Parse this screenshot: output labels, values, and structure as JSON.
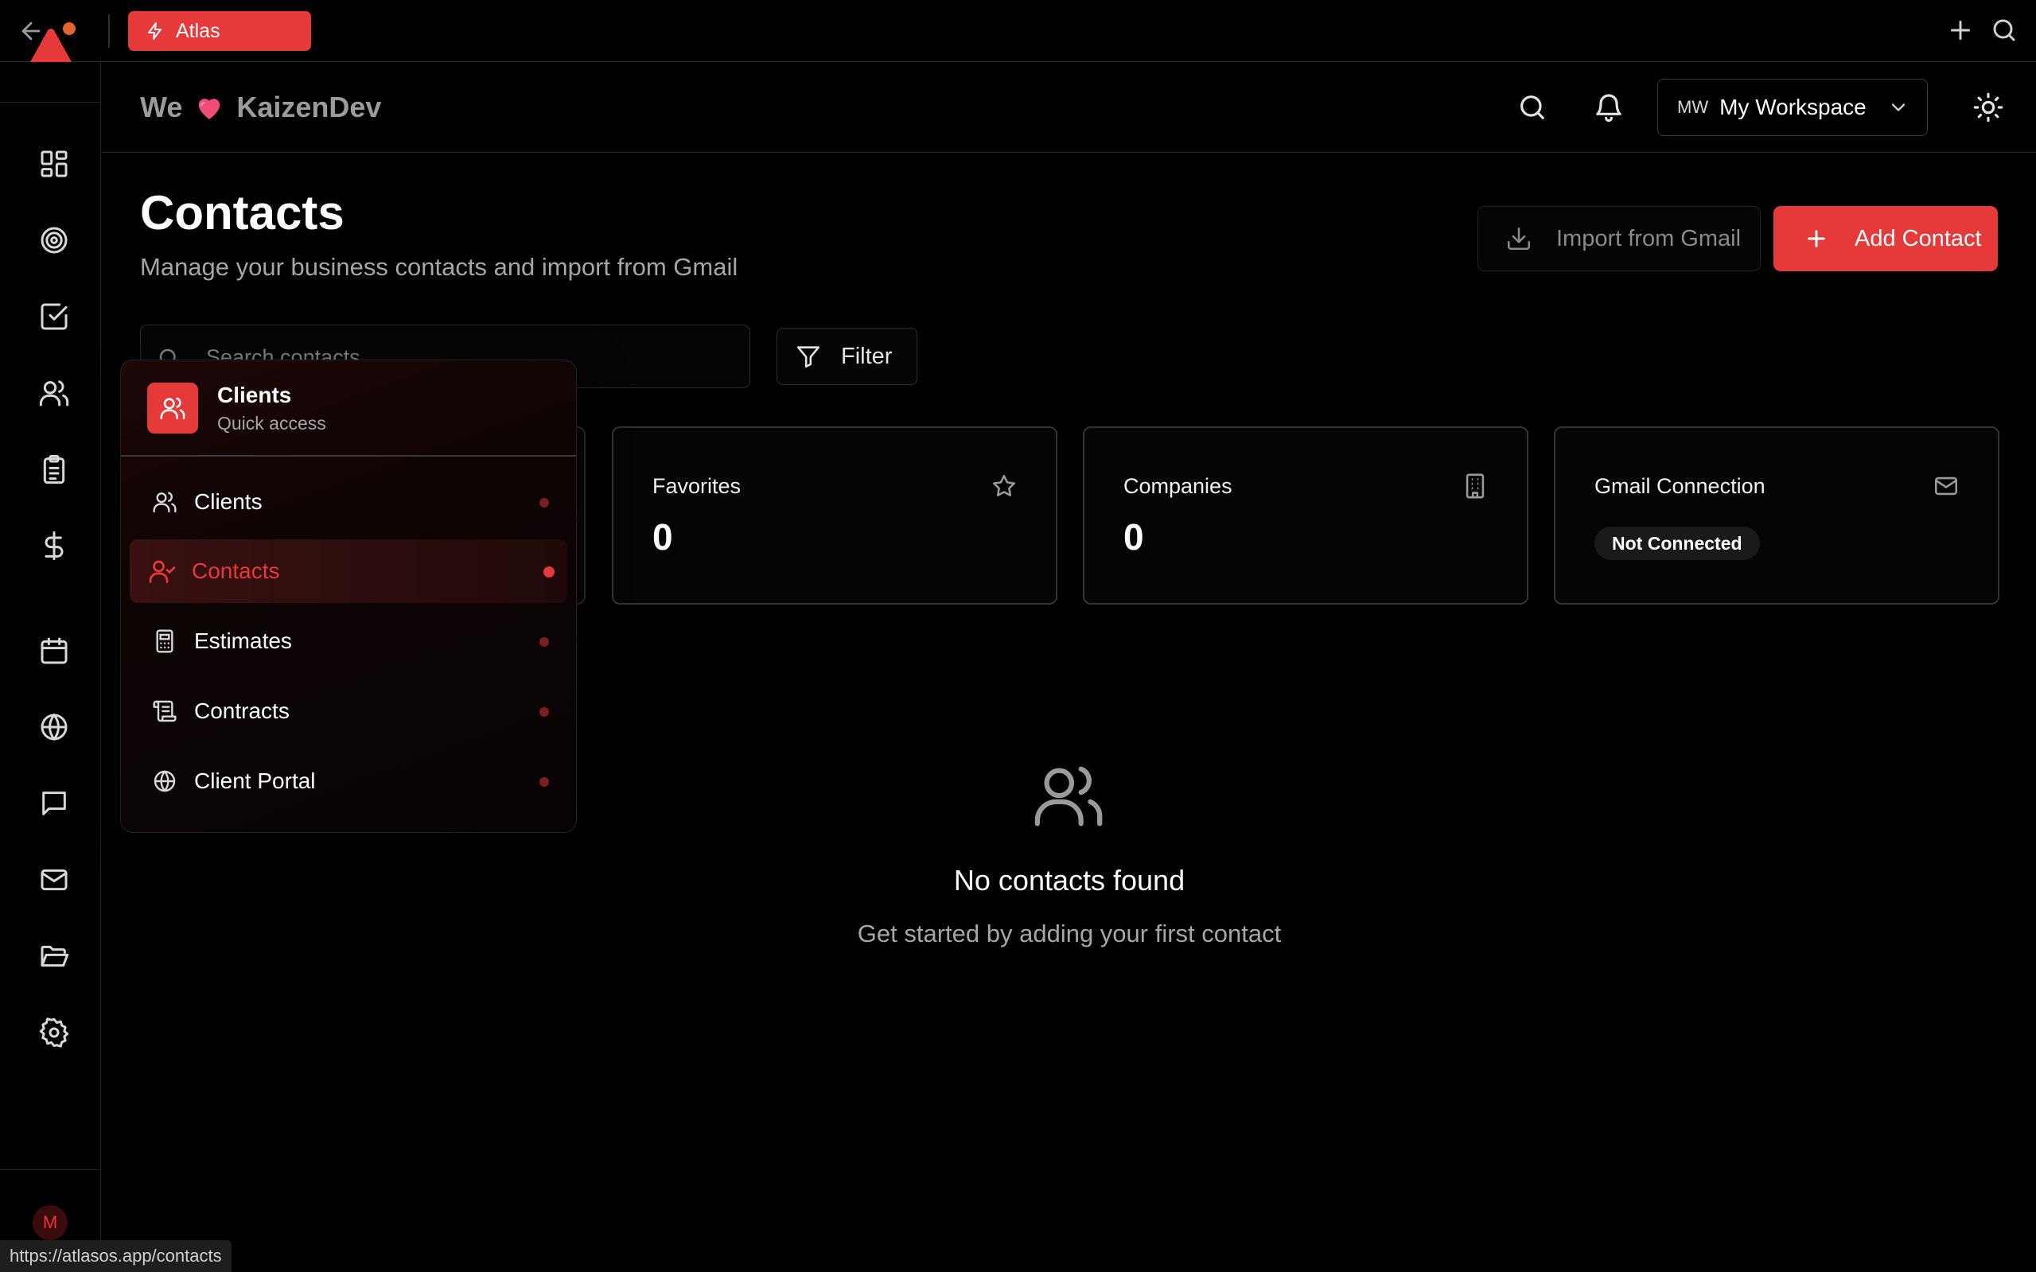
{
  "browser": {
    "tab_label": "Atlas",
    "status_url": "https://atlasos.app/contacts"
  },
  "header": {
    "brand_prefix": "We",
    "brand_name": "KaizenDev",
    "workspace_initials": "MW",
    "workspace_name": "My Workspace"
  },
  "rail": {
    "icons": [
      "dashboard-icon",
      "target-icon",
      "tasks-icon",
      "clients-icon",
      "clipboard-icon",
      "dollar-icon",
      "calendar-icon",
      "globe-icon",
      "chat-icon",
      "mail-icon",
      "folder-icon",
      "settings-icon"
    ],
    "avatar_initial": "M"
  },
  "main": {
    "title": "Contacts",
    "subtitle": "Manage your business contacts and import from Gmail",
    "import_label": "Import from Gmail",
    "add_label": "Add Contact",
    "search_placeholder": "Search contacts",
    "filter_label": "Filter",
    "stats": [
      {
        "label": "Favorites",
        "value": "0",
        "icon": "star-icon"
      },
      {
        "label": "Companies",
        "value": "0",
        "icon": "building-icon"
      },
      {
        "label": "Gmail Connection",
        "badge": "Not Connected",
        "icon": "mail-icon"
      }
    ],
    "empty_title": "No contacts found",
    "empty_subtitle": "Get started by adding your first contact"
  },
  "popover": {
    "title": "Clients",
    "subtitle": "Quick access",
    "items": [
      {
        "label": "Clients",
        "icon": "users-icon",
        "active": false
      },
      {
        "label": "Contacts",
        "icon": "user-check-icon",
        "active": true
      },
      {
        "label": "Estimates",
        "icon": "calculator-icon",
        "active": false
      },
      {
        "label": "Contracts",
        "icon": "scroll-icon",
        "active": false
      },
      {
        "label": "Client Portal",
        "icon": "globe-icon",
        "active": false
      }
    ]
  },
  "colors": {
    "accent": "#e5393a",
    "background": "#000000",
    "muted_text": "#a6a6a6"
  }
}
